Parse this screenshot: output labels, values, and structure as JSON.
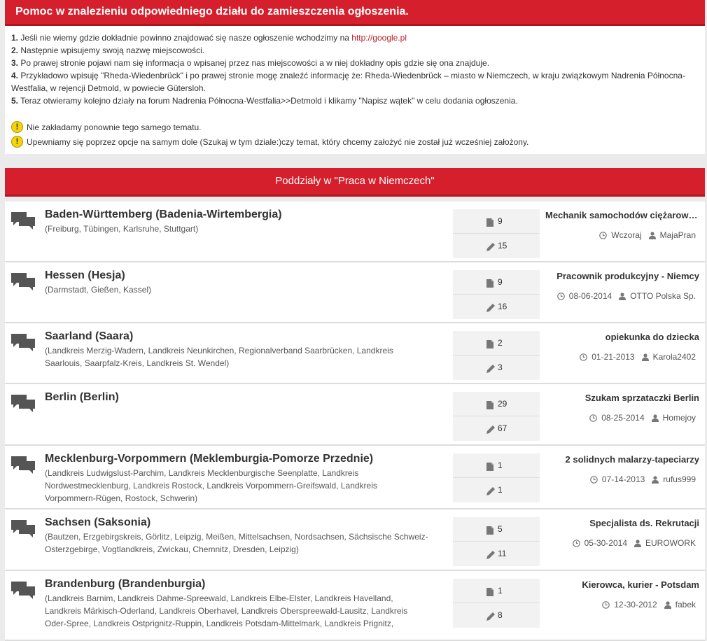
{
  "help": {
    "title": "Pomoc w znalezieniu odpowiedniego działu do zamieszczenia ogłoszenia.",
    "steps": [
      {
        "num": "1.",
        "text": " Jeśli nie wiemy gdzie dokładnie powinno znajdować się nasze ogłoszenie wchodzimy na ",
        "link": "http://google.pl"
      },
      {
        "num": "2.",
        "text": " Następnie wpisujemy swoją nazwę miejscowości."
      },
      {
        "num": "3.",
        "text": " Po prawej stronie pojawi nam się informacja o wpisanej przez nas miejscowości a w niej dokładny opis gdzie się ona znajduje."
      },
      {
        "num": "4.",
        "text": " Przykładowo wpisuję \"Rheda-Wiedenbrück\" i po prawej stronie mogę znaleźć informację że: Rheda-Wiedenbrück – miasto w Niemczech, w kraju związkowym Nadrenia Północna-Westfalia, w rejencji Detmold, w powiecie Gütersloh."
      },
      {
        "num": "5.",
        "text": " Teraz otwieramy kolejno działy na forum Nadrenia Północna-Westfalia>>Detmold i klikamy \"Napisz wątek\" w celu dodania ogłoszenia."
      }
    ],
    "warnings": [
      "Nie zakładamy ponownie tego samego tematu.",
      "Upewniamy się poprzez opcje na samym dole (Szukaj w tym dziale:)czy temat, który chcemy założyć nie został już wcześniej założony."
    ],
    "warning_symbol": "!"
  },
  "subforums": {
    "header": "Poddziały w \"Praca w Niemczech\"",
    "forums": [
      {
        "title": "Baden-Württemberg (Badenia-Wirtembergia)",
        "desc": "(Freiburg, Tübingen, Karlsruhe, Stuttgart)",
        "threads": "9",
        "posts": "15",
        "last_title": "Mechanik samochodów ciężarowych",
        "last_date": "Wczoraj",
        "last_user": "MajaPran"
      },
      {
        "title": "Hessen (Hesja)",
        "desc": "(Darmstadt, Gießen, Kassel)",
        "threads": "9",
        "posts": "16",
        "last_title": "Pracownik produkcyjny - Niemcy",
        "last_date": "08-06-2014",
        "last_user": "OTTO Polska Sp."
      },
      {
        "title": "Saarland (Saara)",
        "desc": "(Landkreis Merzig-Wadern, Landkreis Neunkirchen, Regionalverband Saarbrücken, Landkreis Saarlouis, Saarpfalz-Kreis, Landkreis St. Wendel)",
        "threads": "2",
        "posts": "3",
        "last_title": "opiekunka do dziecka",
        "last_date": "01-21-2013",
        "last_user": "Karola2402"
      },
      {
        "title": "Berlin (Berlin)",
        "desc": "",
        "threads": "29",
        "posts": "67",
        "last_title": "Szukam sprzataczki Berlin",
        "last_date": "08-25-2014",
        "last_user": "Homejoy"
      },
      {
        "title": "Mecklenburg-Vorpommern (Meklemburgia-Pomorze Przednie)",
        "desc": "(Landkreis Ludwigslust-Parchim, Landkreis Mecklenburgische Seenplatte, Landkreis Nordwestmecklenburg, Landkreis Rostock, Landkreis Vorpommern-Greifswald, Landkreis Vorpommern-Rügen, Rostock, Schwerin)",
        "threads": "1",
        "posts": "1",
        "last_title": "2 solidnych malarzy-tapeciarzy",
        "last_date": "07-14-2013",
        "last_user": "rufus999"
      },
      {
        "title": "Sachsen (Saksonia)",
        "desc": "(Bautzen, Erzgebirgskreis, Görlitz, Leipzig, Meißen, Mittelsachsen, Nordsachsen, Sächsische Schweiz-Osterzgebirge, Vogtlandkreis, Zwickau, Chemnitz, Dresden, Leipzig)",
        "threads": "5",
        "posts": "11",
        "last_title": "Specjalista ds. Rekrutacji",
        "last_date": "05-30-2014",
        "last_user": "EUROWORK"
      },
      {
        "title": "Brandenburg (Brandenburgia)",
        "desc": "(Landkreis Barnim, Landkreis Dahme-Spreewald, Landkreis Elbe-Elster, Landkreis Havelland, Landkreis Märkisch-Oderland, Landkreis Oberhavel, Landkreis Oberspreewald-Lausitz, Landkreis Oder-Spree, Landkreis Ostprignitz-Ruppin, Landkreis Potsdam-Mittelmark, Landkreis Prignitz,",
        "threads": "1",
        "posts": "8",
        "last_title": "Kierowca, kurier - Potsdam",
        "last_date": "12-30-2012",
        "last_user": "fabek"
      }
    ]
  },
  "colors": {
    "header_red": "#d61f2c",
    "link_red": "#b9202b"
  }
}
